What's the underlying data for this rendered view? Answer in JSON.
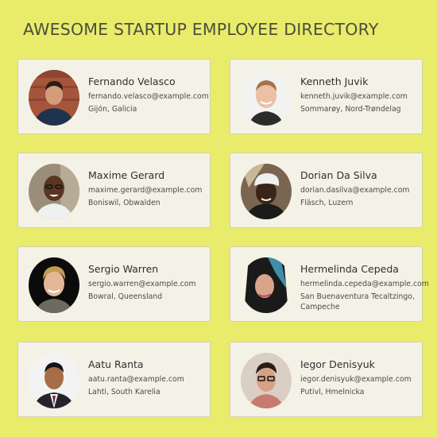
{
  "page": {
    "title": "AWESOME STARTUP EMPLOYEE DIRECTORY"
  },
  "colors": {
    "background": "#e8ec6a",
    "card": "#f4f2e7",
    "card_border": "#d3d1b0"
  },
  "employees": [
    {
      "name": "Fernando Velasco",
      "email": "fernando.velasco@example.com",
      "location": "Gijón, Galicia",
      "avatar": "avatar-photo"
    },
    {
      "name": "Kenneth Juvik",
      "email": "kenneth.juvik@example.com",
      "location": "Sommarøy, Nord-Trøndelag",
      "avatar": "avatar-photo"
    },
    {
      "name": "Maxime Gerard",
      "email": "maxime.gerard@example.com",
      "location": "Boniswil, Obwalden",
      "avatar": "avatar-photo"
    },
    {
      "name": "Dorian Da Silva",
      "email": "dorian.dasilva@example.com",
      "location": "Fläsch, Luzern",
      "avatar": "avatar-photo"
    },
    {
      "name": "Sergio Warren",
      "email": "sergio.warren@example.com",
      "location": "Bowral, Queensland",
      "avatar": "avatar-photo"
    },
    {
      "name": "Hermelinda Cepeda",
      "email": "hermelinda.cepeda@example.com",
      "location": "San Buenaventura Tecaltzingo, Campeche",
      "avatar": "avatar-photo"
    },
    {
      "name": "Aatu Ranta",
      "email": "aatu.ranta@example.com",
      "location": "Lahti, South Karelia",
      "avatar": "avatar-photo"
    },
    {
      "name": "Iegor Denisyuk",
      "email": "iegor.denisyuk@example.com",
      "location": "Putivl, Hmelnicka",
      "avatar": "avatar-photo"
    }
  ]
}
